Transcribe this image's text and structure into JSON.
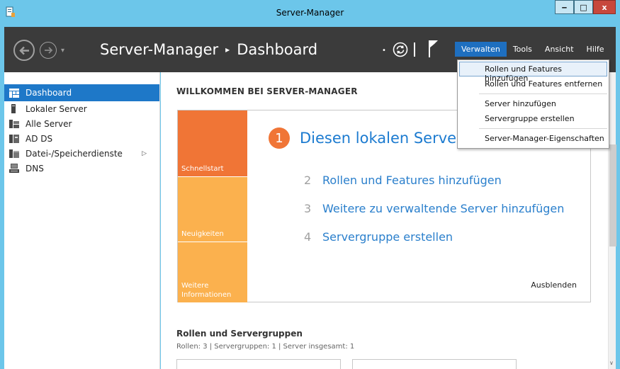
{
  "window": {
    "title": "Server-Manager",
    "minimize": "‒",
    "maximize": "□",
    "close": "x"
  },
  "header": {
    "breadcrumb_root": "Server-Manager",
    "breadcrumb_sep": "▸",
    "breadcrumb_page": "Dashboard",
    "menu": [
      "Verwalten",
      "Tools",
      "Ansicht",
      "Hilfe"
    ]
  },
  "sidebar": {
    "items": [
      {
        "label": "Dashboard"
      },
      {
        "label": "Lokaler Server"
      },
      {
        "label": "Alle Server"
      },
      {
        "label": "AD DS"
      },
      {
        "label": "Datei-/Speicherdienste"
      },
      {
        "label": "DNS"
      }
    ],
    "expand_arrow": "▷"
  },
  "main": {
    "welcome": "WILLKOMMEN BEI SERVER-MANAGER",
    "tiles": [
      "Schnellstart",
      "Neuigkeiten",
      "Weitere Informationen"
    ],
    "quickstart": {
      "num": "1",
      "title": "Diesen lokalen Server konfigurieren",
      "steps": [
        {
          "n": "2",
          "label": "Rollen und Features hinzufügen"
        },
        {
          "n": "3",
          "label": "Weitere zu verwaltende Server hinzufügen"
        },
        {
          "n": "4",
          "label": "Servergruppe erstellen"
        }
      ],
      "hide": "Ausblenden"
    },
    "roles_title": "Rollen und Servergruppen",
    "roles_sub": "Rollen: 3  |  Servergruppen: 1  |  Server insgesamt: 1"
  },
  "dropdown": {
    "items": [
      "Rollen und Features hinzufügen",
      "Rollen und Features entfernen",
      "Server hinzufügen",
      "Servergruppe erstellen",
      "Server-Manager-Eigenschaften"
    ]
  },
  "colors": {
    "accent": "#1e78c8",
    "tile_orange": "#f07536",
    "tile_yellow": "#fbb14e",
    "header": "#3b3b3b",
    "frame": "#6cc6ea"
  }
}
